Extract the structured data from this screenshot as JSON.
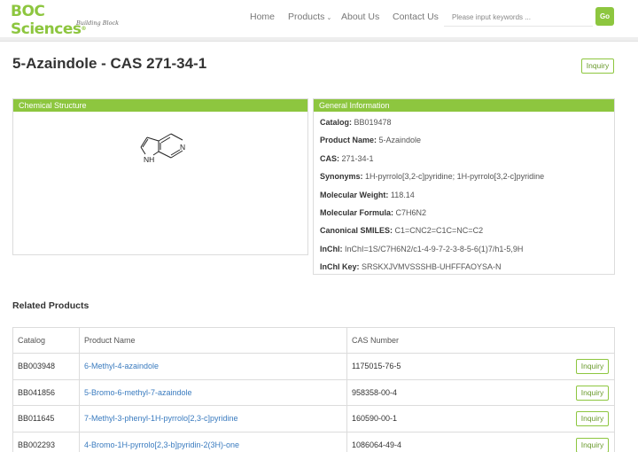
{
  "header": {
    "logo_main": "BOC Sciences",
    "logo_reg": "®",
    "logo_tagline": "Building Block",
    "nav": {
      "home": "Home",
      "products": "Products",
      "about": "About Us",
      "contact": "Contact Us"
    },
    "search": {
      "placeholder": "Please input keywords ..."
    },
    "go_label": "Go"
  },
  "page": {
    "title": "5-Azaindole - CAS 271-34-1",
    "inquiry_label": "Inquiry"
  },
  "structure_panel": {
    "title": "Chemical Structure",
    "atoms": {
      "n_ring6": "N",
      "nh_ring5": "NH"
    }
  },
  "general_info": {
    "title": "General Information",
    "rows": [
      {
        "key": "Catalog:",
        "value": "BB019478"
      },
      {
        "key": "Product Name:",
        "value": "5-Azaindole"
      },
      {
        "key": "CAS:",
        "value": "271-34-1"
      },
      {
        "key": "Synonyms:",
        "value": "1H-pyrrolo[3,2-c]pyridine; 1H-pyrrolo[3,2-c]pyridine"
      },
      {
        "key": "Molecular Weight:",
        "value": "118.14"
      },
      {
        "key": "Molecular Formula:",
        "value": "C7H6N2"
      },
      {
        "key": "Canonical SMILES:",
        "value": "C1=CNC2=C1C=NC=C2"
      },
      {
        "key": "InChI:",
        "value": "InChI=1S/C7H6N2/c1-4-9-7-2-3-8-5-6(1)7/h1-5,9H"
      },
      {
        "key": "InChI Key:",
        "value": "SRSKXJVMVSSSHB-UHFFFAOYSA-N"
      }
    ]
  },
  "related": {
    "title": "Related Products",
    "columns": [
      "Catalog",
      "Product Name",
      "CAS Number"
    ],
    "rows": [
      {
        "catalog": "BB003948",
        "name": "6-Methyl-4-azaindole",
        "cas": "1175015-76-5",
        "inquiry": "Inquiry"
      },
      {
        "catalog": "BB041856",
        "name": "5-Bromo-6-methyl-7-azaindole",
        "cas": "958358-00-4",
        "inquiry": "Inquiry"
      },
      {
        "catalog": "BB011645",
        "name": "7-Methyl-3-phenyl-1H-pyrrolo[2,3-c]pyridine",
        "cas": "160590-00-1",
        "inquiry": "Inquiry"
      },
      {
        "catalog": "BB002293",
        "name": "4-Bromo-1H-pyrrolo[2,3-b]pyridin-2(3H)-one",
        "cas": "1086064-49-4",
        "inquiry": "Inquiry"
      }
    ]
  },
  "colors": {
    "brand_green": "#8dc63f",
    "link_blue": "#3a7bbf"
  }
}
